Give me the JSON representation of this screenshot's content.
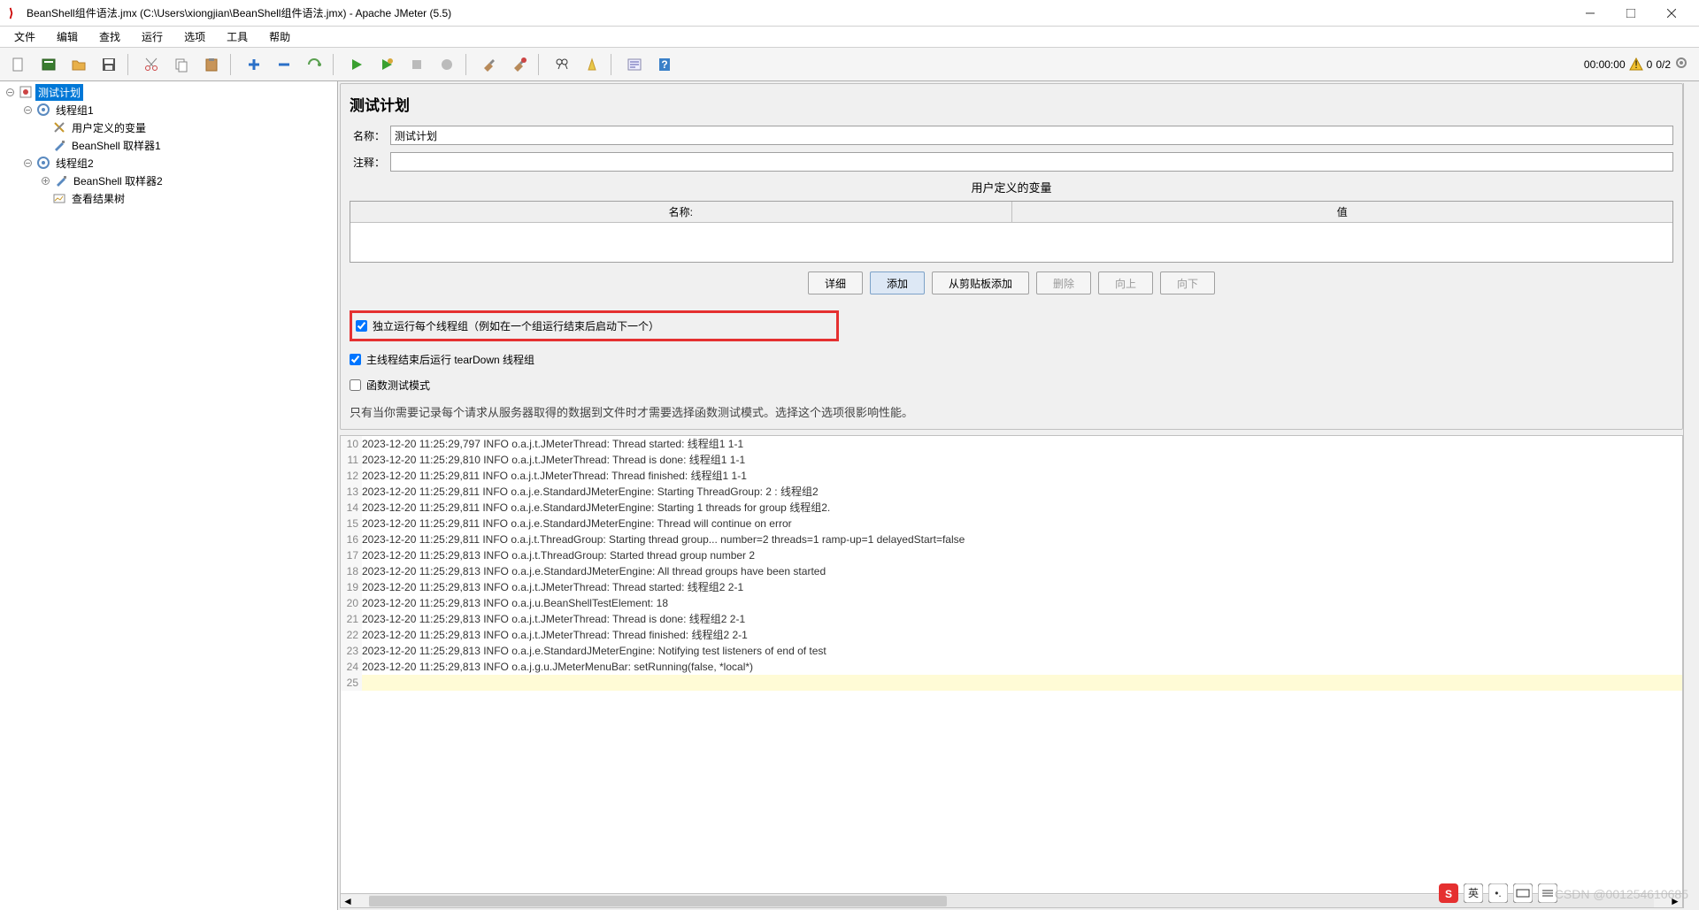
{
  "titlebar": {
    "title": "BeanShell组件语法.jmx (C:\\Users\\xiongjian\\BeanShell组件语法.jmx) - Apache JMeter (5.5)"
  },
  "menu": {
    "file": "文件",
    "edit": "编辑",
    "find": "查找",
    "run": "运行",
    "options": "选项",
    "tools": "工具",
    "help": "帮助"
  },
  "toolbar_right": {
    "timer": "00:00:00",
    "warn_count": "0",
    "threads": "0/2"
  },
  "tree": {
    "root": "测试计划",
    "tg1": "线程组1",
    "udv": "用户定义的变量",
    "bs1": "BeanShell 取样器1",
    "tg2": "线程组2",
    "bs2": "BeanShell 取样器2",
    "vrt": "查看结果树"
  },
  "form": {
    "title": "测试计划",
    "name_label": "名称：",
    "name_value": "测试计划",
    "comment_label": "注释：",
    "comment_value": ""
  },
  "vars": {
    "section_title": "用户定义的变量",
    "col_name": "名称:",
    "col_value": "值"
  },
  "buttons": {
    "detail": "详细",
    "add": "添加",
    "from_clip": "从剪贴板添加",
    "delete": "删除",
    "up": "向上",
    "down": "向下"
  },
  "checks": {
    "independent": "独立运行每个线程组（例如在一个组运行结束后启动下一个）",
    "teardown": "主线程结束后运行 tearDown 线程组",
    "func_mode": "函数测试模式"
  },
  "desc": "只有当你需要记录每个请求从服务器取得的数据到文件时才需要选择函数测试模式。选择这个选项很影响性能。",
  "log": [
    {
      "n": "10",
      "t": "2023-12-20 11:25:29,797 INFO o.a.j.t.JMeterThread: Thread started: 线程组1 1-1"
    },
    {
      "n": "11",
      "t": "2023-12-20 11:25:29,810 INFO o.a.j.t.JMeterThread: Thread is done: 线程组1 1-1"
    },
    {
      "n": "12",
      "t": "2023-12-20 11:25:29,811 INFO o.a.j.t.JMeterThread: Thread finished: 线程组1 1-1"
    },
    {
      "n": "13",
      "t": "2023-12-20 11:25:29,811 INFO o.a.j.e.StandardJMeterEngine: Starting ThreadGroup: 2 : 线程组2"
    },
    {
      "n": "14",
      "t": "2023-12-20 11:25:29,811 INFO o.a.j.e.StandardJMeterEngine: Starting 1 threads for group 线程组2."
    },
    {
      "n": "15",
      "t": "2023-12-20 11:25:29,811 INFO o.a.j.e.StandardJMeterEngine: Thread will continue on error"
    },
    {
      "n": "16",
      "t": "2023-12-20 11:25:29,811 INFO o.a.j.t.ThreadGroup: Starting thread group... number=2 threads=1 ramp-up=1 delayedStart=false"
    },
    {
      "n": "17",
      "t": "2023-12-20 11:25:29,813 INFO o.a.j.t.ThreadGroup: Started thread group number 2"
    },
    {
      "n": "18",
      "t": "2023-12-20 11:25:29,813 INFO o.a.j.e.StandardJMeterEngine: All thread groups have been started"
    },
    {
      "n": "19",
      "t": "2023-12-20 11:25:29,813 INFO o.a.j.t.JMeterThread: Thread started: 线程组2 2-1"
    },
    {
      "n": "20",
      "t": "2023-12-20 11:25:29,813 INFO o.a.j.u.BeanShellTestElement: 18"
    },
    {
      "n": "21",
      "t": "2023-12-20 11:25:29,813 INFO o.a.j.t.JMeterThread: Thread is done: 线程组2 2-1"
    },
    {
      "n": "22",
      "t": "2023-12-20 11:25:29,813 INFO o.a.j.t.JMeterThread: Thread finished: 线程组2 2-1"
    },
    {
      "n": "23",
      "t": "2023-12-20 11:25:29,813 INFO o.a.j.e.StandardJMeterEngine: Notifying test listeners of end of test"
    },
    {
      "n": "24",
      "t": "2023-12-20 11:25:29,813 INFO o.a.j.g.u.JMeterMenuBar: setRunning(false, *local*)"
    },
    {
      "n": "25",
      "t": ""
    }
  ],
  "watermark": "CSDN @001254610685"
}
